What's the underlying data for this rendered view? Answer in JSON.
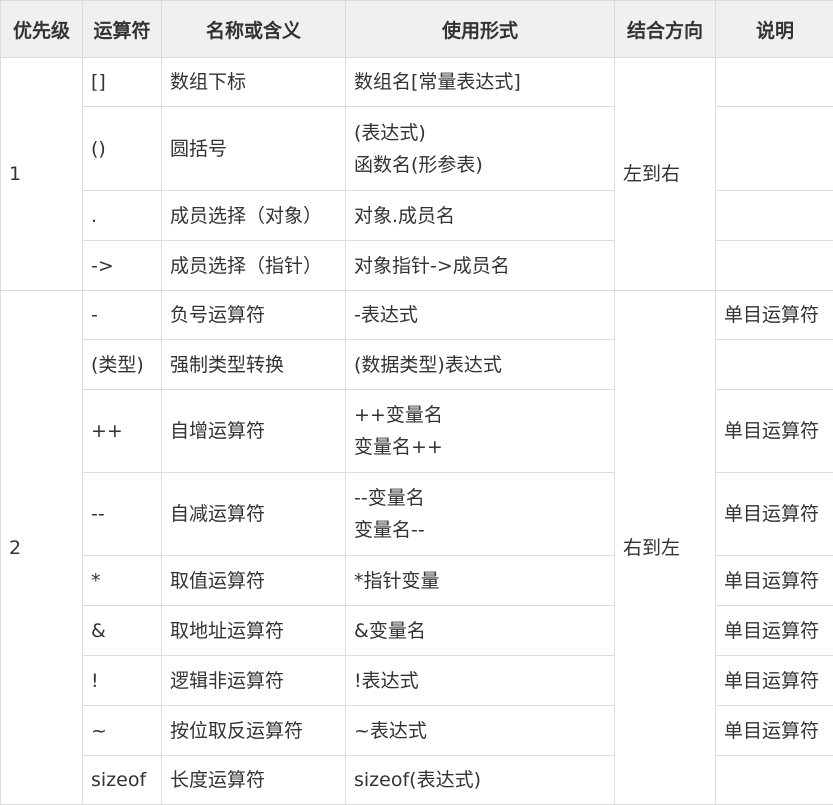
{
  "headers": [
    "优先级",
    "运算符",
    "名称或含义",
    "使用形式",
    "结合方向",
    "说明"
  ],
  "groups": [
    {
      "priority": "1",
      "direction": "左到右",
      "rows": [
        {
          "op": "[]",
          "name": "数组下标",
          "usage": [
            "数组名[常量表达式]"
          ],
          "note": ""
        },
        {
          "op": "()",
          "name": "圆括号",
          "usage": [
            "(表达式)",
            "函数名(形参表)"
          ],
          "note": ""
        },
        {
          "op": ".",
          "name": "成员选择（对象）",
          "usage": [
            "对象.成员名"
          ],
          "note": ""
        },
        {
          "op": "->",
          "name": "成员选择（指针）",
          "usage": [
            "对象指针->成员名"
          ],
          "note": ""
        }
      ]
    },
    {
      "priority": "2",
      "direction": "右到左",
      "rows": [
        {
          "op": "-",
          "name": "负号运算符",
          "usage": [
            "-表达式"
          ],
          "note": "单目运算符"
        },
        {
          "op": "(类型)",
          "name": "强制类型转换",
          "usage": [
            "(数据类型)表达式"
          ],
          "note": ""
        },
        {
          "op": "++",
          "name": "自增运算符",
          "usage": [
            "++变量名",
            "变量名++"
          ],
          "note": "单目运算符"
        },
        {
          "op": "--",
          "name": "自减运算符",
          "usage": [
            "--变量名",
            "变量名--"
          ],
          "note": "单目运算符"
        },
        {
          "op": "*",
          "name": "取值运算符",
          "usage": [
            "*指针变量"
          ],
          "note": "单目运算符"
        },
        {
          "op": "&",
          "name": "取地址运算符",
          "usage": [
            "&变量名"
          ],
          "note": "单目运算符"
        },
        {
          "op": "!",
          "name": "逻辑非运算符",
          "usage": [
            "!表达式"
          ],
          "note": "单目运算符"
        },
        {
          "op": "~",
          "name": "按位取反运算符",
          "usage": [
            "~表达式"
          ],
          "note": "单目运算符"
        },
        {
          "op": "sizeof",
          "name": "长度运算符",
          "usage": [
            "sizeof(表达式)"
          ],
          "note": ""
        }
      ]
    }
  ]
}
